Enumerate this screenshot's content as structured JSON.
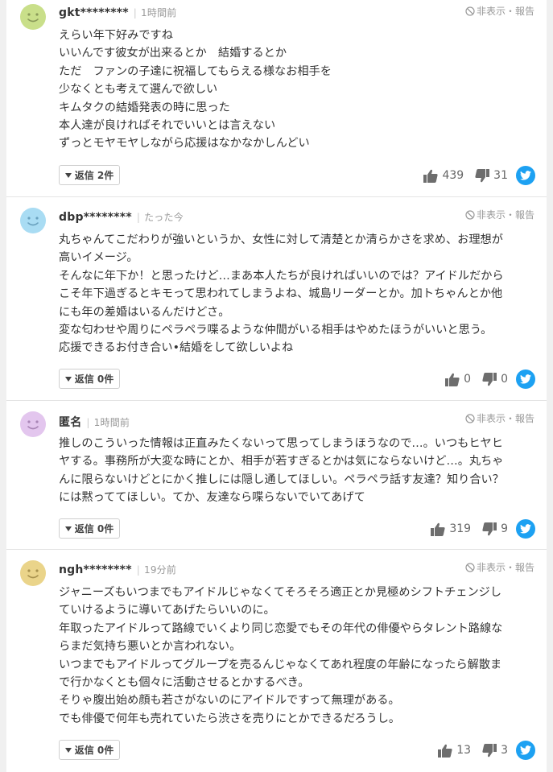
{
  "ui": {
    "report_label": "非表示・報告",
    "reply_prefix": "返信",
    "like_icon": "thumbs-up-icon",
    "dislike_icon": "thumbs-down-icon",
    "share_icon": "twitter-icon",
    "colors": {
      "twitter": "#1da1f2",
      "icon_gray": "#6d6d6d",
      "divider": "#e4e4e4"
    }
  },
  "comments": [
    {
      "username": "gkt********",
      "time": "1時間前",
      "avatar_color": "#c9df8a",
      "lines": [
        "えらい年下好みですね",
        "いいんです彼女が出来るとか　結婚するとか",
        "ただ　ファンの子達に祝福してもらえる様なお相手を",
        "少なくとも考えて選んで欲しい",
        "キムタクの結婚発表の時に思った",
        "本人達が良ければそれでいいとは言えない",
        "ずっとモヤモヤしながら応援はなかなかしんどい"
      ],
      "reply_label": "返信 2件",
      "likes": "439",
      "dislikes": "31"
    },
    {
      "username": "dbp********",
      "time": "たった今",
      "avatar_color": "#a9dcf3",
      "lines": [
        "丸ちゃんてこだわりが強いというか、女性に対して清楚とか清らかさを求め、お理想が",
        "高いイメージ。",
        "そんなに年下か！と思ったけど…まあ本人たちが良ければいいのでは？アイドルだから",
        "こそ年下過ぎるとキモって思われてしまうよね、城島リーダーとか。加トちゃんとか他",
        "にも年の差婚はいるんだけどさ。",
        "変な匂わせや周りにペラペラ喋るような仲間がいる相手はやめたほうがいいと思う。",
        "応援できるお付き合い•結婚をして欲しいよね"
      ],
      "reply_label": "返信 0件",
      "likes": "0",
      "dislikes": "0"
    },
    {
      "username": "匿名",
      "time": "1時間前",
      "avatar_color": "#e3c6ee",
      "lines": [
        "推しのこういった情報は正直みたくないって思ってしまうほうなので…。いつもヒヤヒ",
        "ヤする。事務所が大変な時にとか、相手が若すぎるとかは気にならないけど…。丸ちゃ",
        "んに限らないけどとにかく推しには隠し通してほしい。ペラペラ話す友達？知り合い？",
        "には黙っててほしい。てか、友達なら喋らないでいてあげて"
      ],
      "reply_label": "返信 0件",
      "likes": "319",
      "dislikes": "9"
    },
    {
      "username": "ngh********",
      "time": "19分前",
      "avatar_color": "#ead48a",
      "lines": [
        "ジャニーズもいつまでもアイドルじゃなくてそろそろ適正とか見極めシフトチェンジし",
        "ていけるように導いてあげたらいいのに。",
        "年取ったアイドルって路線でいくより同じ恋愛でもその年代の俳優やらタレント路線な",
        "らまだ気持ち悪いとか言われない。",
        "いつまでもアイドルってグループを売るんじゃなくてあれ程度の年齢になったら解散ま",
        "で行かなくとも個々に活動させるとかするべき。",
        "そりゃ腹出始め顔も若さがないのにアイドルですって無理がある。",
        "でも俳優で何年も売れていたら渋さを売りにとかできるだろうし。"
      ],
      "reply_label": "返信 0件",
      "likes": "13",
      "dislikes": "3"
    }
  ]
}
